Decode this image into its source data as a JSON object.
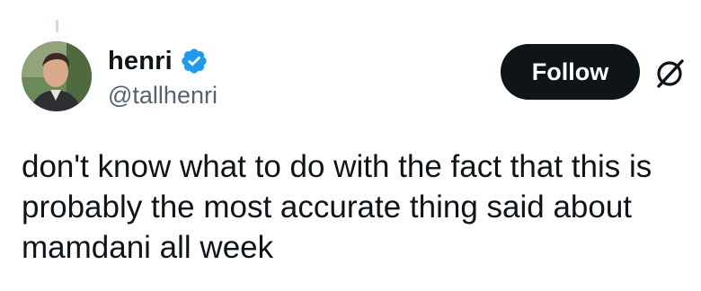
{
  "tweet": {
    "author": {
      "display_name": "henri",
      "handle": "@tallhenri",
      "verified": true,
      "avatar_icon": "profile-photo"
    },
    "follow_label": "Follow",
    "menu_icon": "grok-icon",
    "text_lines": [
      "don't know what to do with the fact that this is",
      "probably the most accurate thing said about",
      "mamdani all week"
    ]
  },
  "colors": {
    "primary_text": "#0f1419",
    "secondary_text": "#536471",
    "verified_blue": "#1d9bf0",
    "follow_button_bg": "#0f1419",
    "follow_button_text": "#ffffff"
  }
}
